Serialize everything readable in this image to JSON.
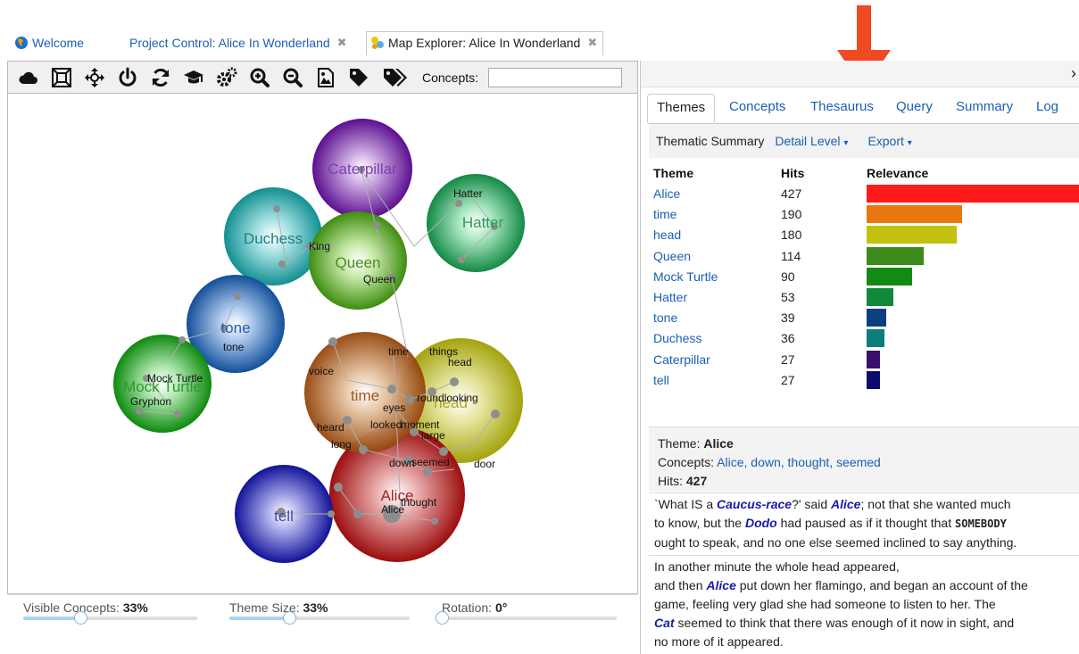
{
  "window_tabs": [
    {
      "label": "Welcome",
      "icon": "globe-icon",
      "close": ""
    },
    {
      "label": "Project Control: Alice In Wonderland",
      "close": "✖"
    },
    {
      "label": "Map Explorer: Alice In Wonderland",
      "icon": "map-explorer-icon",
      "close": "✖"
    }
  ],
  "toolbar": {
    "icons": [
      "cloud-icon",
      "fit-to-view-icon",
      "move-icon",
      "power-icon",
      "refresh-icon",
      "graduation-cap-icon",
      "settings-cogs-icon",
      "zoom-in-icon",
      "zoom-out-icon",
      "image-export-icon",
      "tag-icon",
      "tags-icon"
    ],
    "concepts_label": "Concepts:",
    "concepts_value": ""
  },
  "map": {
    "themes": [
      {
        "name": "Caterpillar",
        "color": "#6a1b9a",
        "text_color": "#7a3fb0"
      },
      {
        "name": "Hatter",
        "color": "#1e8f4e",
        "text_color": "#2d9a58"
      },
      {
        "name": "Duchess",
        "color": "#199ea0",
        "text_color": "#1f7f86"
      },
      {
        "name": "Queen",
        "color": "#4c9a1a",
        "text_color": "#4c8a25"
      },
      {
        "name": "tone",
        "color": "#1f5ea8",
        "text_color": "#2b5fa4"
      },
      {
        "name": "Mock Turtle",
        "color": "#1c9a1c",
        "text_color": "#2e9a2e"
      },
      {
        "name": "head",
        "color": "#b5b51a",
        "text_color": "#a6a62a"
      },
      {
        "name": "time",
        "color": "#a9561a",
        "text_color": "#9a5a22"
      },
      {
        "name": "Alice",
        "color": "#b01818",
        "text_color": "#a32020"
      },
      {
        "name": "tell",
        "color": "#1f1fa8",
        "text_color": "#4a4aa8"
      }
    ],
    "concepts": [
      "Hatter",
      "King",
      "Queen",
      "tone",
      "Mock Turtle",
      "Gryphon",
      "time",
      "things",
      "head",
      "voice",
      "roundlooking",
      "eyes",
      "looked",
      "moment",
      "heard",
      "large",
      "long",
      "down",
      "seemed",
      "door",
      "Alice",
      "thought"
    ]
  },
  "footer": {
    "visible_concepts_label": "Visible Concepts:",
    "visible_concepts_value": "33%",
    "visible_concepts_level": 0.33,
    "theme_size_label": "Theme Size:",
    "theme_size_value": "33%",
    "theme_size_level": 0.33,
    "rotation_label": "Rotation:",
    "rotation_value": "0°",
    "rotation_level": 0
  },
  "panel": {
    "collapse_icon": "chevron-right-icon",
    "tabs": [
      "Themes",
      "Concepts",
      "Thesaurus",
      "Query",
      "Summary",
      "Log"
    ],
    "active_tab": "Themes",
    "subbar": {
      "label": "Thematic Summary",
      "detail_level": "Detail Level",
      "export": "Export",
      "caret": "▾"
    },
    "columns": {
      "theme": "Theme",
      "hits": "Hits",
      "relevance": "Relevance"
    },
    "rows": [
      {
        "theme": "Alice",
        "hits": "427",
        "relevance": 1.0,
        "color": "#ff1a1a"
      },
      {
        "theme": "time",
        "hits": "190",
        "relevance": 0.445,
        "color": "#e87710"
      },
      {
        "theme": "head",
        "hits": "180",
        "relevance": 0.42,
        "color": "#c1c110"
      },
      {
        "theme": "Queen",
        "hits": "114",
        "relevance": 0.267,
        "color": "#3b8a1a"
      },
      {
        "theme": "Mock Turtle",
        "hits": "90",
        "relevance": 0.211,
        "color": "#138a13"
      },
      {
        "theme": "Hatter",
        "hits": "53",
        "relevance": 0.124,
        "color": "#108a3a"
      },
      {
        "theme": "tone",
        "hits": "39",
        "relevance": 0.091,
        "color": "#0b3f80"
      },
      {
        "theme": "Duchess",
        "hits": "36",
        "relevance": 0.084,
        "color": "#0f7c7c"
      },
      {
        "theme": "Caterpillar",
        "hits": "27",
        "relevance": 0.063,
        "color": "#3b0f70"
      },
      {
        "theme": "tell",
        "hits": "27",
        "relevance": 0.063,
        "color": "#0b0b6e"
      }
    ],
    "info": {
      "theme_label": "Theme:",
      "theme_value": "Alice",
      "concepts_label": "Concepts:",
      "concepts_value": "Alice, down, thought, seemed",
      "hits_label": "Hits:",
      "hits_value": "427"
    },
    "passage1": {
      "t1": "`What IS a ",
      "k1": "Caucus-race",
      "t2": "?' said ",
      "k2": "Alice",
      "t3": "; not that she wanted much\nto know, but the ",
      "k3": "Dodo",
      "t4": " had paused as if it thought that ",
      "caps": "SOMEBODY",
      "t5": "\nought to speak, and no one else seemed inclined to say anything."
    },
    "passage2": {
      "t1": "In another minute the whole head appeared,\nand then ",
      "k1": "Alice",
      "t2": " put down her flamingo, and began an account of the\ngame, feeling very glad she had someone to listen to her. The\n",
      "k2": "Cat",
      "t3": " seemed to think that there was enough of it now in sight, and\nno more of it appeared."
    }
  }
}
